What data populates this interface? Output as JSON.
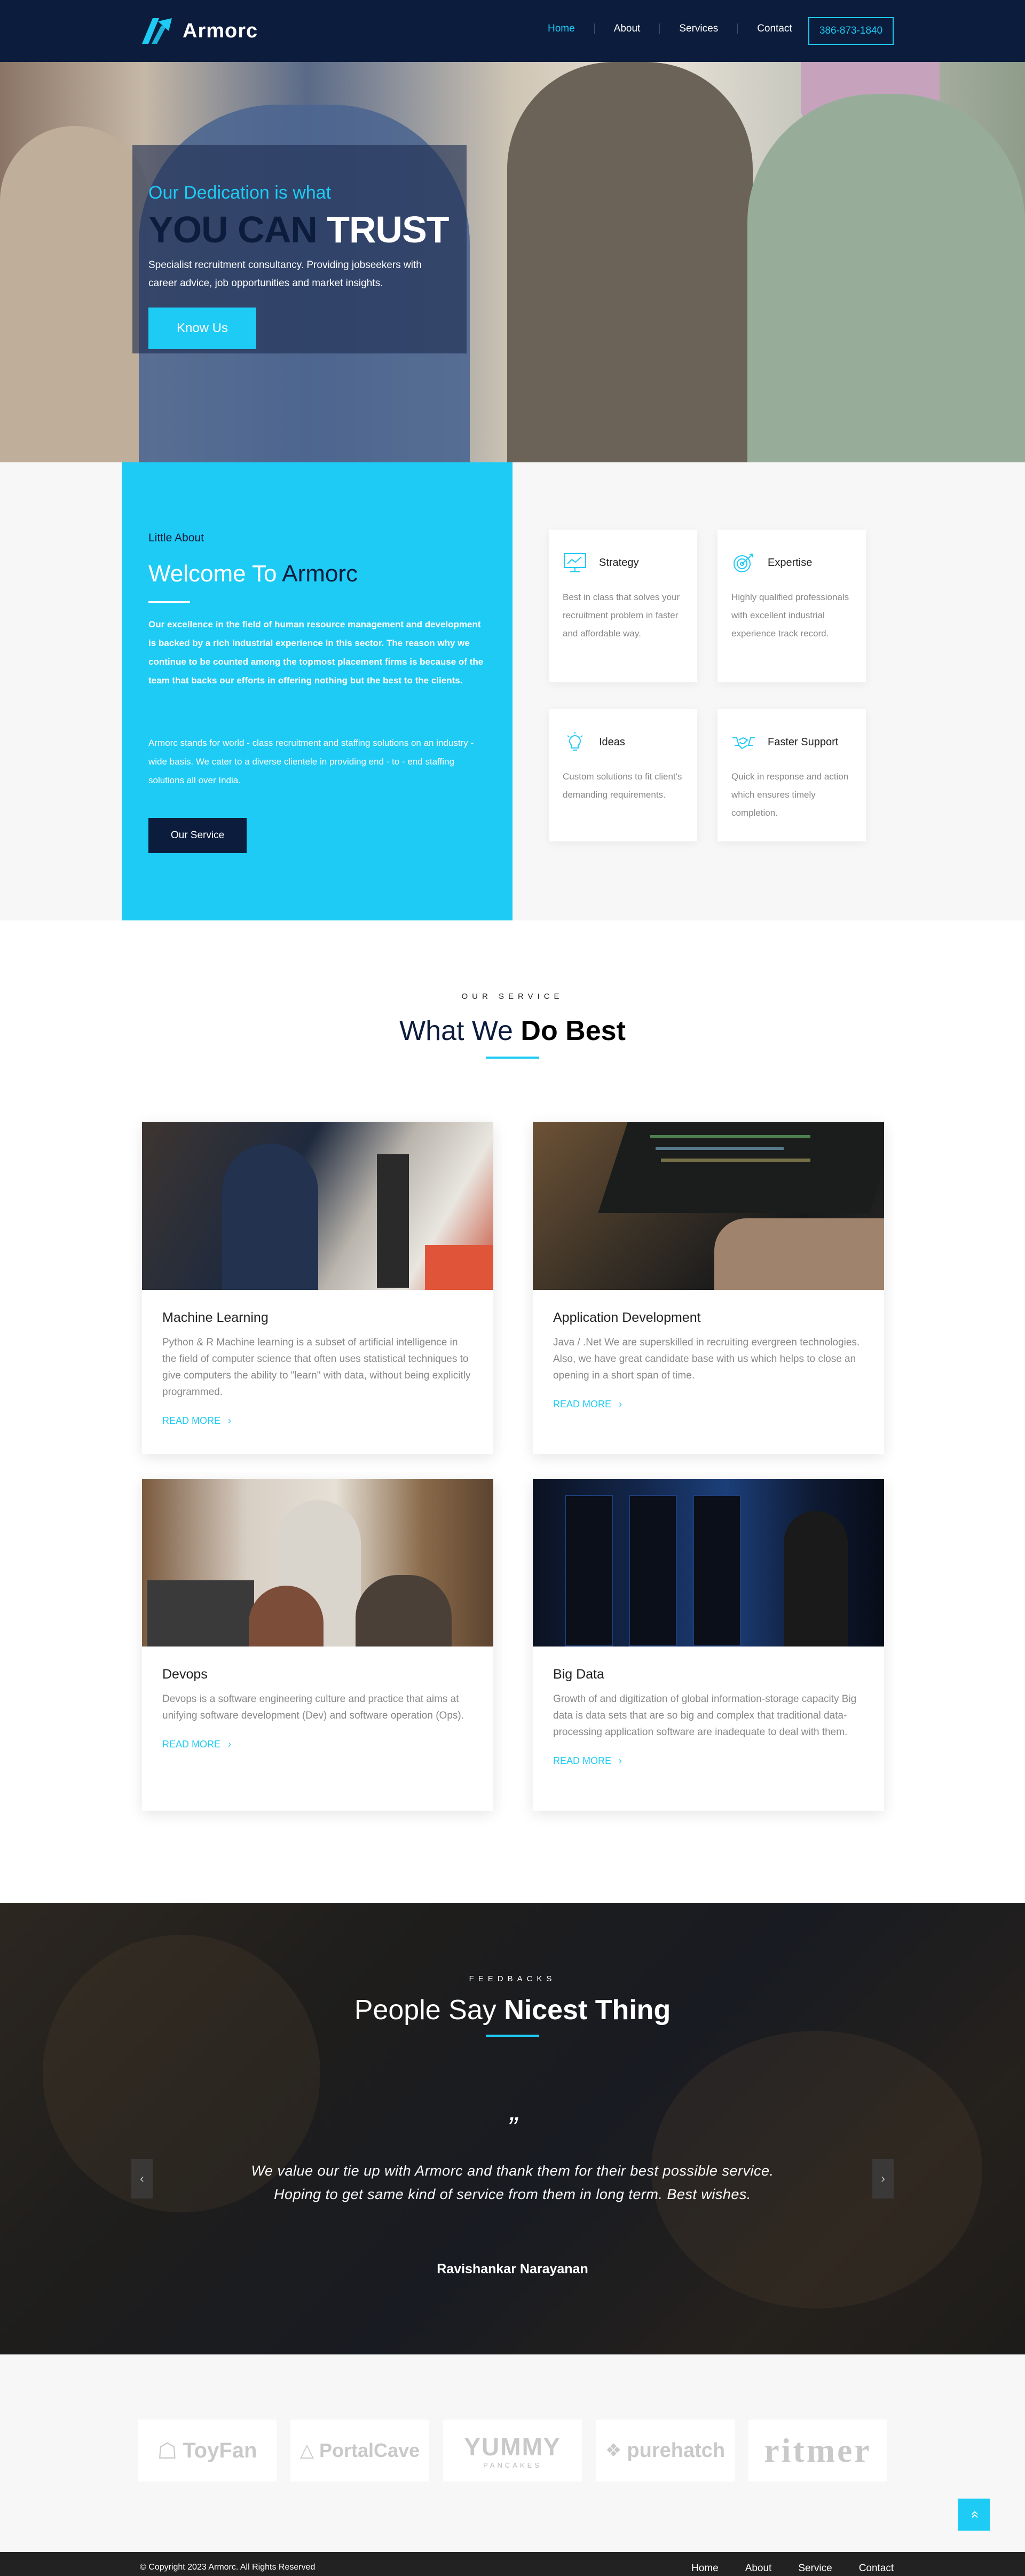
{
  "colors": {
    "accent": "#1ecbf5",
    "navy": "#0c1c3c"
  },
  "brand": {
    "name": "Armorc"
  },
  "nav": {
    "items": [
      {
        "label": "Home",
        "active": true
      },
      {
        "label": "About"
      },
      {
        "label": "Services"
      },
      {
        "label": "Contact"
      }
    ],
    "phone": "386-873-1840"
  },
  "hero": {
    "subtitle": "Our Dedication is what",
    "title_dark": "YOU CAN",
    "title_light": "TRUST",
    "description": "Specialist recruitment consultancy. Providing jobseekers with career advice, job opportunities and market insights.",
    "button": "Know Us"
  },
  "about": {
    "kicker": "Little About",
    "title_light": "Welcome To",
    "title_dark": "Armorc",
    "para1": "Our excellence in the field of human resource management and development is backed by a rich industrial experience in this sector. The reason why we continue to be counted among the topmost placement firms is because of the team that backs our efforts in offering nothing but the best to the clients.",
    "para2": "Armorc stands for world - class recruitment and staffing solutions on an industry - wide basis. We cater to a diverse clientele in providing end - to - end staffing solutions all over India.",
    "button": "Our Service",
    "features": [
      {
        "title": "Strategy",
        "icon": "monitor-chart-icon",
        "desc": "Best in class that solves your recruitment problem in faster and affordable way."
      },
      {
        "title": "Expertise",
        "icon": "target-icon",
        "desc": "Highly qualified professionals with excellent industrial experience track record."
      },
      {
        "title": "Ideas",
        "icon": "lightbulb-icon",
        "desc": "Custom solutions to fit client's demanding requirements."
      },
      {
        "title": "Faster Support",
        "icon": "handshake-icon",
        "desc": "Quick in response and action which ensures timely completion."
      }
    ]
  },
  "services": {
    "kicker": "OUR SERVICE",
    "title_light": "What We",
    "title_bold": "Do Best",
    "more_label": "READ MORE",
    "cards": [
      {
        "title": "Machine Learning",
        "desc": "Python & R Machine learning is a subset of artificial intelligence in the field of computer science that often uses statistical techniques to give computers the ability to \"learn\" with data, without being explicitly programmed."
      },
      {
        "title": "Application Development",
        "desc": "Java / .Net We are superskilled in recruiting evergreen technologies. Also, we have great candidate base with us which helps to close an opening in a short span of time."
      },
      {
        "title": "Devops",
        "desc": "Devops is a software engineering culture and practice that aims at unifying software development (Dev) and software operation (Ops)."
      },
      {
        "title": "Big Data",
        "desc": "Growth of and digitization of global information-storage capacity Big data is data sets that are so big and complex that traditional data-processing application software are inadequate to deal with them."
      }
    ]
  },
  "testimonials": {
    "kicker": "FEEDBACKS",
    "title_light": "People Say",
    "title_bold": "Nicest Thing",
    "quote_mark": "”",
    "text": "We value our tie up with Armorc and thank them for their best possible service. Hoping to get same kind of service from them in long term. Best wishes.",
    "author": "Ravishankar Narayanan",
    "prev": "‹",
    "next": "›"
  },
  "clients": [
    "ToyFan",
    "PortalCave",
    "YUMMY",
    "purehatch",
    "ritmer"
  ],
  "client_sub": {
    "yummy": "PANCAKES"
  },
  "footer": {
    "copyright": "© Copyright 2023 Armorc. All Rights Reserved",
    "links": [
      "Home",
      "About",
      "Service",
      "Contact"
    ]
  },
  "to_top": "»"
}
